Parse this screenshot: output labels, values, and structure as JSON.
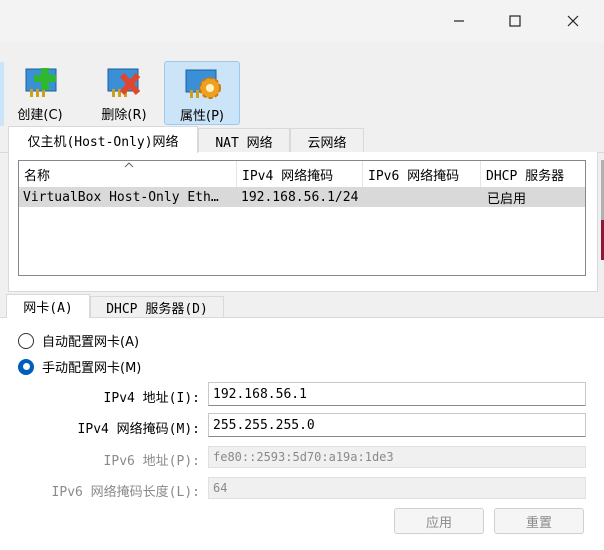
{
  "window": {
    "minimize_icon": "minimize-icon",
    "maximize_icon": "maximize-icon",
    "close_icon": "close-icon"
  },
  "toolbar": {
    "create": "创建(C)",
    "delete": "删除(R)",
    "properties": "属性(P)"
  },
  "tabs": {
    "host_only": "仅主机(Host-Only)网络",
    "nat": "NAT 网络",
    "cloud": "云网络"
  },
  "table": {
    "columns": [
      "名称",
      "IPv4 网络掩码",
      "IPv6 网络掩码",
      "DHCP 服务器"
    ],
    "rows": [
      [
        "VirtualBox Host-Only Eth…",
        "192.168.56.1/24",
        "",
        "已启用"
      ]
    ]
  },
  "subtabs": {
    "adapter": "网卡(A)",
    "dhcp": "DHCP 服务器(D)"
  },
  "adapter": {
    "auto_label": "自动配置网卡(A)",
    "manual_label": "手动配置网卡(M)",
    "mode": "manual",
    "ipv4_addr_label": "IPv4 地址(I):",
    "ipv4_addr_value": "192.168.56.1",
    "ipv4_mask_label": "IPv4 网络掩码(M):",
    "ipv4_mask_value": "255.255.255.0",
    "ipv6_addr_label": "IPv6 地址(P):",
    "ipv6_addr_value": "fe80::2593:5d70:a19a:1de3",
    "ipv6_prefix_label": "IPv6 网络掩码长度(L):",
    "ipv6_prefix_value": "64"
  },
  "buttons": {
    "apply": "应用",
    "reset": "重置"
  }
}
